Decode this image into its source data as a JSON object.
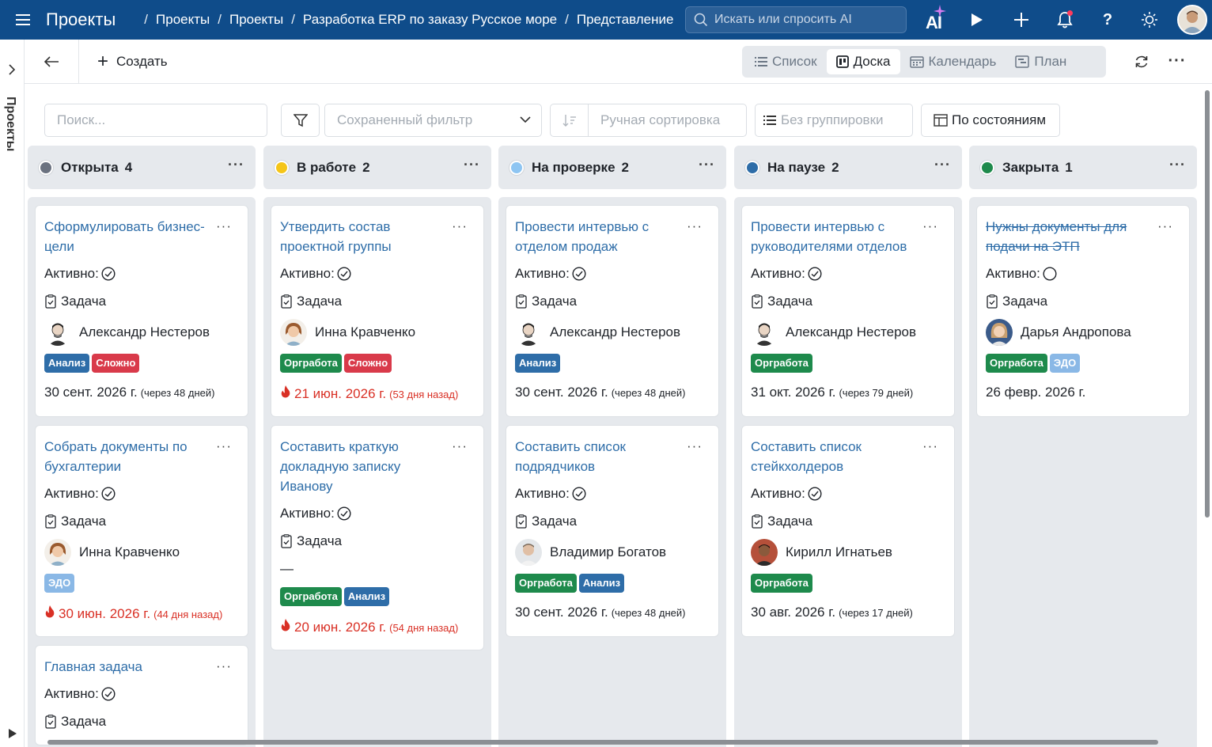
{
  "header": {
    "app_title": "Проекты",
    "breadcrumbs": [
      "Проекты",
      "Проекты",
      "Разработка ERP по заказу Русское море",
      "Представление"
    ],
    "search_placeholder": "Искать или спросить AI",
    "ai_label": "AI"
  },
  "sidebar": {
    "label": "Проекты"
  },
  "toolbar": {
    "create_label": "Создать",
    "views": [
      {
        "label": "Список",
        "icon": "list-icon",
        "active": false
      },
      {
        "label": "Доска",
        "icon": "board-icon",
        "active": true
      },
      {
        "label": "Календарь",
        "icon": "calendar-icon",
        "active": false
      },
      {
        "label": "План",
        "icon": "gantt-icon",
        "active": false
      }
    ]
  },
  "filters": {
    "search_placeholder": "Поиск...",
    "saved_filter_placeholder": "Сохраненный фильтр",
    "sort_label": "Ручная сортировка",
    "group_label": "Без группировки",
    "by_state_label": "По состояниям"
  },
  "labels": {
    "active": "Активно:",
    "task": "Задача"
  },
  "tag_colors": {
    "Анализ": "#2e6da8",
    "Сложно": "#d93a4a",
    "Оргработа": "#1e8a4c",
    "ЭДО": "#8ab8e6"
  },
  "columns": [
    {
      "name": "Открыта",
      "count": "4",
      "color": "#6b7280",
      "cards": [
        {
          "title": "Сформулировать бизнес-цели",
          "done": true,
          "assignee": "Александр Нестеров",
          "avatar": "male-1",
          "tags": [
            "Анализ",
            "Сложно"
          ],
          "date": "30 сент. 2026 г.",
          "rel": "(через 48 дней)",
          "overdue": false
        },
        {
          "title": "Собрать документы по бухгалтерии",
          "done": true,
          "assignee": "Инна Кравченко",
          "avatar": "female-1",
          "tags": [
            "ЭДО"
          ],
          "date": "30 июн. 2026 г.",
          "rel": "(44 дня назад)",
          "overdue": true
        },
        {
          "title": "Главная задача",
          "done": true,
          "assignee": "",
          "avatar": "",
          "tags": [],
          "date": "",
          "rel": "",
          "overdue": false
        }
      ]
    },
    {
      "name": "В работе",
      "count": "2",
      "color": "#f5c518",
      "cards": [
        {
          "title": "Утвердить состав проектной группы",
          "done": true,
          "assignee": "Инна Кравченко",
          "avatar": "female-1",
          "tags": [
            "Оргработа",
            "Сложно"
          ],
          "date": "21 июн. 2026 г.",
          "rel": "(53 дня назад)",
          "overdue": true
        },
        {
          "title": "Составить краткую докладную записку Иванову",
          "done": true,
          "assignee": "—",
          "avatar": "",
          "tags": [
            "Оргработа",
            "Анализ"
          ],
          "date": "20 июн. 2026 г.",
          "rel": "(54 дня назад)",
          "overdue": true
        }
      ]
    },
    {
      "name": "На проверке",
      "count": "2",
      "color": "#8ec5f2",
      "cards": [
        {
          "title": "Провести интервью с отделом продаж",
          "done": true,
          "assignee": "Александр Нестеров",
          "avatar": "male-1",
          "tags": [
            "Анализ"
          ],
          "date": "30 сент. 2026 г.",
          "rel": "(через 48 дней)",
          "overdue": false
        },
        {
          "title": "Составить список подрядчиков",
          "done": true,
          "assignee": "Владимир Богатов",
          "avatar": "male-2",
          "tags": [
            "Оргработа",
            "Анализ"
          ],
          "date": "30 сент. 2026 г.",
          "rel": "(через 48 дней)",
          "overdue": false
        }
      ]
    },
    {
      "name": "На паузе",
      "count": "2",
      "color": "#2e6da8",
      "cards": [
        {
          "title": "Провести интервью с руководителями отделов",
          "done": true,
          "assignee": "Александр Нестеров",
          "avatar": "male-1",
          "tags": [
            "Оргработа"
          ],
          "date": "31 окт. 2026 г.",
          "rel": "(через 79 дней)",
          "overdue": false
        },
        {
          "title": "Составить список стейкхолдеров",
          "done": true,
          "assignee": "Кирилл Игнатьев",
          "avatar": "male-3",
          "tags": [
            "Оргработа"
          ],
          "date": "30 авг. 2026 г.",
          "rel": "(через 17 дней)",
          "overdue": false
        }
      ]
    },
    {
      "name": "Закрыта",
      "count": "1",
      "color": "#1e8a4c",
      "cards": [
        {
          "title": "Нужны документы для подачи на ЭТП",
          "done": false,
          "strike": true,
          "assignee": "Дарья Андропова",
          "avatar": "female-2",
          "tags": [
            "Оргработа",
            "ЭДО"
          ],
          "date": "26 февр. 2026 г.",
          "rel": "",
          "overdue": false
        }
      ]
    }
  ]
}
